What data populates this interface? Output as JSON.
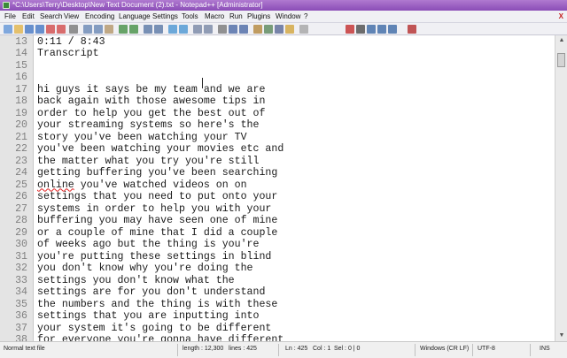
{
  "window": {
    "title": "*C:\\Users\\Terry\\Desktop\\New Text Document (2).txt - Notepad++ [Administrator]"
  },
  "menu": [
    "File",
    "Edit",
    "Search",
    "View",
    "Encoding",
    "Language",
    "Settings",
    "Tools",
    "Macro",
    "Run",
    "Plugins",
    "Window",
    "?"
  ],
  "window_controls": "X",
  "toolbar_icons": [
    "new-file-icon",
    "open-file-icon",
    "save-icon",
    "save-all-icon",
    "close-icon",
    "close-all-icon",
    "print-icon",
    "cut-icon",
    "copy-icon",
    "paste-icon",
    "undo-icon",
    "redo-icon",
    "find-icon",
    "replace-icon",
    "zoom-in-icon",
    "zoom-out-icon",
    "sync-v-icon",
    "sync-h-icon",
    "word-wrap-icon",
    "show-all-chars-icon",
    "indent-guide-icon",
    "udl-icon",
    "doc-map-icon",
    "function-list-icon",
    "folder-workspace-icon",
    "monitor-icon",
    "record-macro-icon",
    "stop-record-icon",
    "play-macro-icon",
    "run-macro-icon",
    "save-macro-icon",
    "spell-check-icon"
  ],
  "lines": [
    {
      "n": "13",
      "text": "0:11 / 8:43"
    },
    {
      "n": "14",
      "text": "Transcript"
    },
    {
      "n": "15",
      "text": ""
    },
    {
      "n": "16",
      "text": ""
    },
    {
      "n": "17",
      "text": "hi guys it says be my team and we are"
    },
    {
      "n": "18",
      "text": "back again with those awesome tips in"
    },
    {
      "n": "19",
      "text": "order to help you get the best out of"
    },
    {
      "n": "20",
      "text": "your streaming systems so here's the"
    },
    {
      "n": "21",
      "text": "story you've been watching your TV"
    },
    {
      "n": "22",
      "text": "you've been watching your movies etc and"
    },
    {
      "n": "23",
      "text": "the matter what you try you're still"
    },
    {
      "n": "24",
      "text": "getting buffering you've been searching"
    },
    {
      "n": "25",
      "text": "online you've watched videos on on"
    },
    {
      "n": "26",
      "text": "settings that you need to put onto your"
    },
    {
      "n": "27",
      "text": "systems in order to help you with your"
    },
    {
      "n": "28",
      "text": "buffering you may have seen one of mine"
    },
    {
      "n": "29",
      "text": "or a couple of mine that I did a couple"
    },
    {
      "n": "30",
      "text": "of weeks ago but the thing is you're"
    },
    {
      "n": "31",
      "text": "you're putting these settings in blind"
    },
    {
      "n": "32",
      "text": "you don't know why you're doing the"
    },
    {
      "n": "33",
      "text": "settings you don't know what the"
    },
    {
      "n": "34",
      "text": "settings are for you don't understand"
    },
    {
      "n": "35",
      "text": "the numbers and the thing is with these"
    },
    {
      "n": "36",
      "text": "settings that you are inputting into"
    },
    {
      "n": "37",
      "text": "your system it's going to be different"
    },
    {
      "n": "38",
      "text": "for everyone you're gonna have different"
    }
  ],
  "status": {
    "file_type": "Normal text file",
    "length": "length : 12,300",
    "lines": "lines : 425",
    "ln": "Ln : 425",
    "col": "Col : 1",
    "sel": "Sel : 0 | 0",
    "eol": "Windows (CR LF)",
    "encoding": "UTF-8",
    "mode": "INS"
  }
}
